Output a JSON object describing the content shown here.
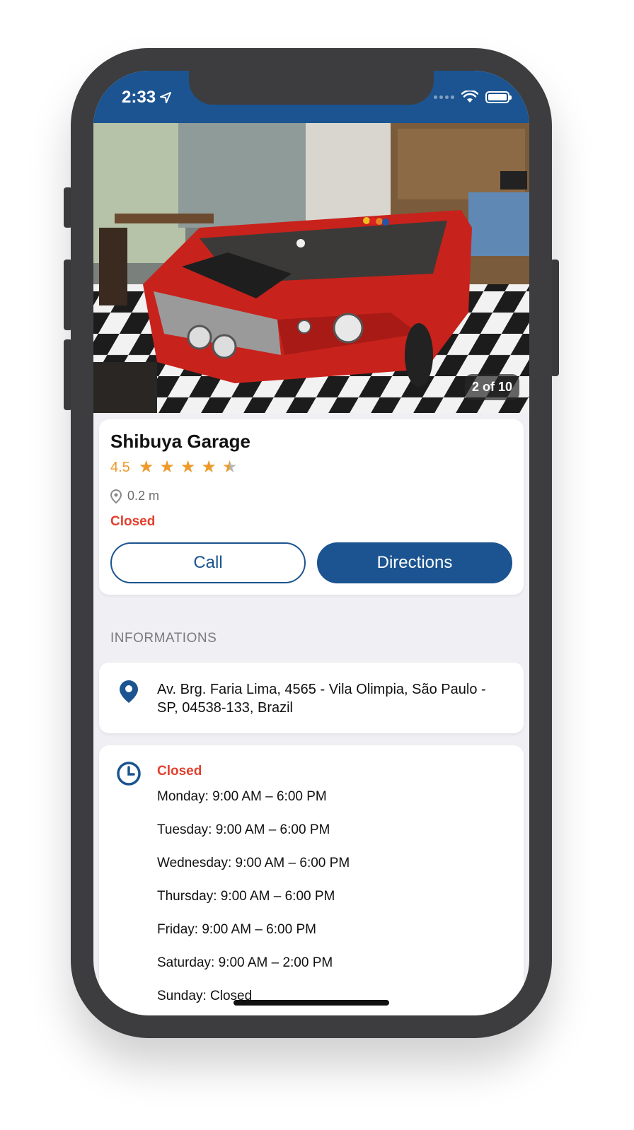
{
  "status_bar": {
    "time": "2:33"
  },
  "gallery": {
    "counter": "2 of 10"
  },
  "place": {
    "name": "Shibuya Garage",
    "rating": "4.5",
    "rating_value": 4.5,
    "rating_max": 5,
    "distance": "0.2 m",
    "open_status": "Closed"
  },
  "actions": {
    "call_label": "Call",
    "directions_label": "Directions"
  },
  "section": {
    "title": "INFORMATIONS"
  },
  "address": {
    "text": "Av. Brg. Faria Lima, 4565 - Vila Olimpia, São Paulo - SP, 04538-133, Brazil"
  },
  "hours": {
    "status": "Closed",
    "days": [
      "Monday: 9:00 AM – 6:00 PM",
      "Tuesday: 9:00 AM – 6:00 PM",
      "Wednesday: 9:00 AM – 6:00 PM",
      "Thursday: 9:00 AM – 6:00 PM",
      "Friday: 9:00 AM – 6:00 PM",
      "Saturday: 9:00 AM – 2:00 PM",
      "Sunday: Closed"
    ]
  },
  "colors": {
    "brand": "#1b5490",
    "closed": "#e2412f",
    "star": "#ed9a2a"
  }
}
